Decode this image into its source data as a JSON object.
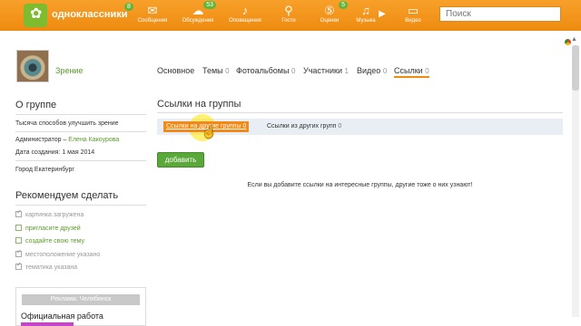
{
  "header": {
    "brand": "одноклассники",
    "brand_badge": "8",
    "nav": [
      {
        "label": "Сообщения",
        "icon": "envelope-icon",
        "badge": ""
      },
      {
        "label": "Обсуждения",
        "icon": "chat-icon",
        "badge": "53"
      },
      {
        "label": "Оповещения",
        "icon": "bell-icon",
        "badge": ""
      },
      {
        "label": "Гости",
        "icon": "footprints-icon",
        "badge": ""
      },
      {
        "label": "Оценки",
        "icon": "rating-icon",
        "badge": "5"
      },
      {
        "label": "Музыка",
        "icon": "music-icon",
        "badge": ""
      },
      {
        "label": "Видео",
        "icon": "video-icon",
        "badge": ""
      }
    ],
    "search_placeholder": "Поиск"
  },
  "group": {
    "name": "Зрение",
    "tabs": [
      {
        "label": "Основное",
        "count": ""
      },
      {
        "label": "Темы",
        "count": "0"
      },
      {
        "label": "Фотоальбомы",
        "count": "0"
      },
      {
        "label": "Участники",
        "count": "1"
      },
      {
        "label": "Видео",
        "count": "0"
      },
      {
        "label": "Ссылки",
        "count": "0",
        "active": true
      }
    ]
  },
  "sidebar": {
    "about_title": "О группе",
    "description": "Тысяча способов улучшить зрение",
    "admin_label": "Администратор –",
    "admin_name": "Елена Какоурова",
    "created": "Дата создания: 1 мая 2014",
    "city": "Город Екатеринбург",
    "recommend_title": "Рекомендуем сделать",
    "todo": [
      {
        "label": "картинка загружена",
        "done": true
      },
      {
        "label": "пригласите друзей",
        "done": false
      },
      {
        "label": "создайте свою тему",
        "done": false
      },
      {
        "label": "местоположение указано",
        "done": true
      },
      {
        "label": "тематика указана",
        "done": true
      }
    ],
    "ad_title": "Реклама: Челябинск",
    "ad_text": "Официальная работа"
  },
  "main": {
    "title": "Ссылки на группы",
    "subtab_active": "Ссылки на другие группы",
    "subtab_active_count": "0",
    "subtab_other": "Ссылки из других групп",
    "subtab_other_count": "0",
    "add_button": "добавить",
    "empty_message": "Если вы добавите ссылки на интересные группы, другие тоже о них узнают!"
  },
  "colors": {
    "header_orange": "#ee8b10",
    "green": "#5a9b2b",
    "button_green": "#5aa83a"
  }
}
